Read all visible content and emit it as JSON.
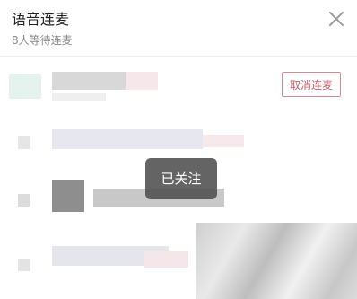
{
  "header": {
    "title": "语音连麦",
    "waiting_count": "8人等待连麦"
  },
  "icons": {
    "close": "close-icon"
  },
  "queue": {
    "cancel_label": "取消连麦"
  },
  "toast": {
    "text": "已关注"
  },
  "colors": {
    "accent": "#c65f69",
    "toast_bg": "#4e4e4e"
  }
}
